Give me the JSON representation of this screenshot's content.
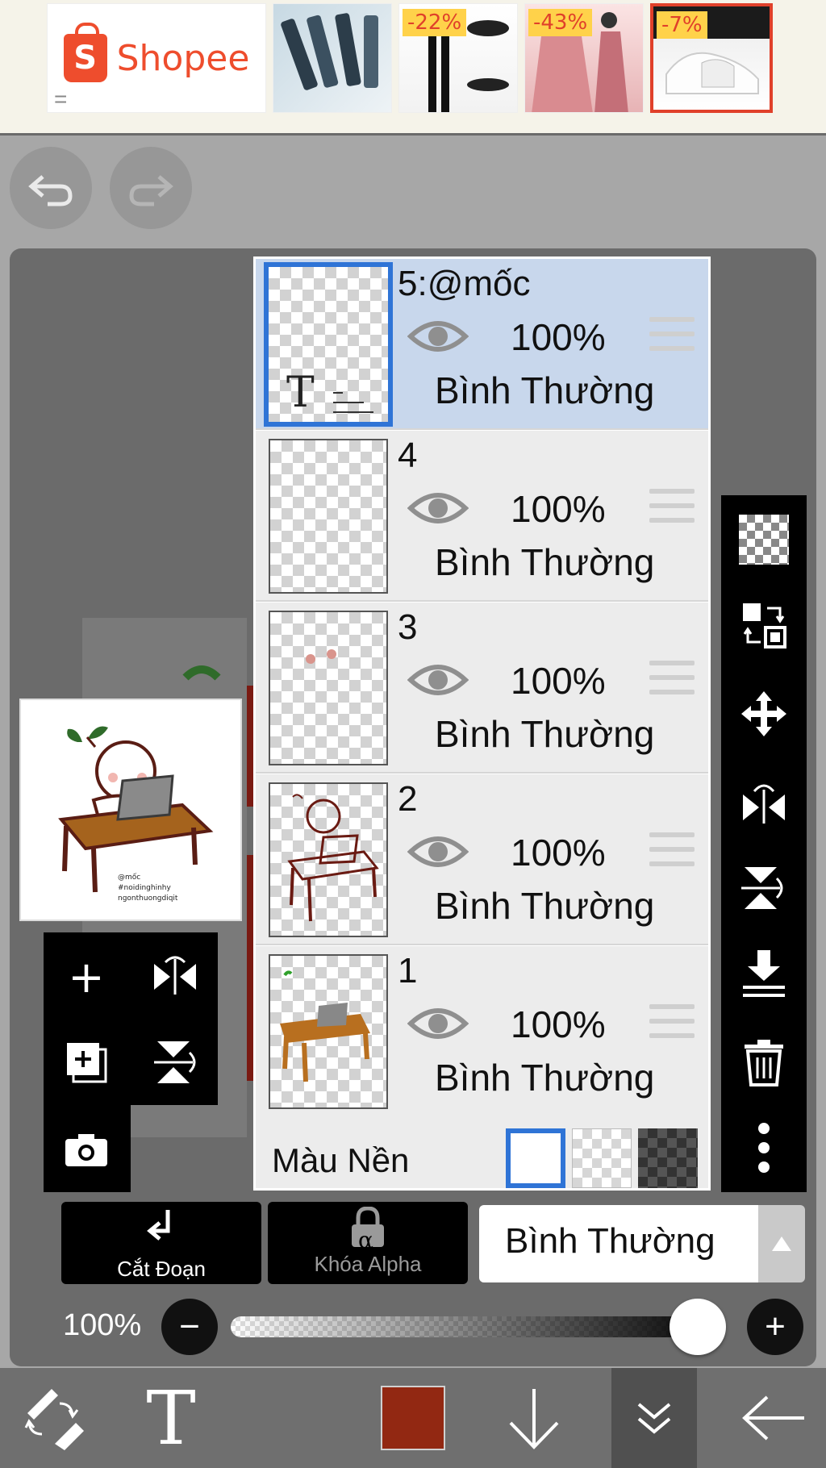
{
  "ad": {
    "brand": "Shopee",
    "brand_color": "#ee4d2d",
    "products": [
      {
        "badge": ""
      },
      {
        "badge": "-22%"
      },
      {
        "badge": "-43%"
      },
      {
        "badge": "-7%"
      }
    ]
  },
  "toolbar_top": {
    "undo_icon": "undo-arrow-icon",
    "redo_icon": "redo-arrow-icon"
  },
  "layers": [
    {
      "name": "5:@mốc",
      "opacity": "100%",
      "blend": "Bình Thường",
      "active": true
    },
    {
      "name": "4",
      "opacity": "100%",
      "blend": "Bình Thường",
      "active": false
    },
    {
      "name": "3",
      "opacity": "100%",
      "blend": "Bình Thường",
      "active": false
    },
    {
      "name": "2",
      "opacity": "100%",
      "blend": "Bình Thường",
      "active": false
    },
    {
      "name": "1",
      "opacity": "100%",
      "blend": "Bình Thường",
      "active": false
    }
  ],
  "thumb_text": {
    "t_glyph": "T"
  },
  "background": {
    "label": "Màu Nền",
    "options": [
      "white",
      "checker",
      "dark-checker"
    ],
    "selected": "white"
  },
  "preview": {
    "credit_lines": [
      "@mốc",
      "#noidinghinhy",
      "ngonthuongdiqit"
    ]
  },
  "controls": {
    "clip_label": "Cắt Đoạn",
    "alpha_label": "Khóa Alpha",
    "alpha_glyph": "α",
    "blend_value": "Bình Thường",
    "opacity_label": "100%",
    "opacity_value": 1.0
  },
  "bottom_bar": {
    "current_color": "#922812",
    "text_tool_glyph": "T"
  }
}
